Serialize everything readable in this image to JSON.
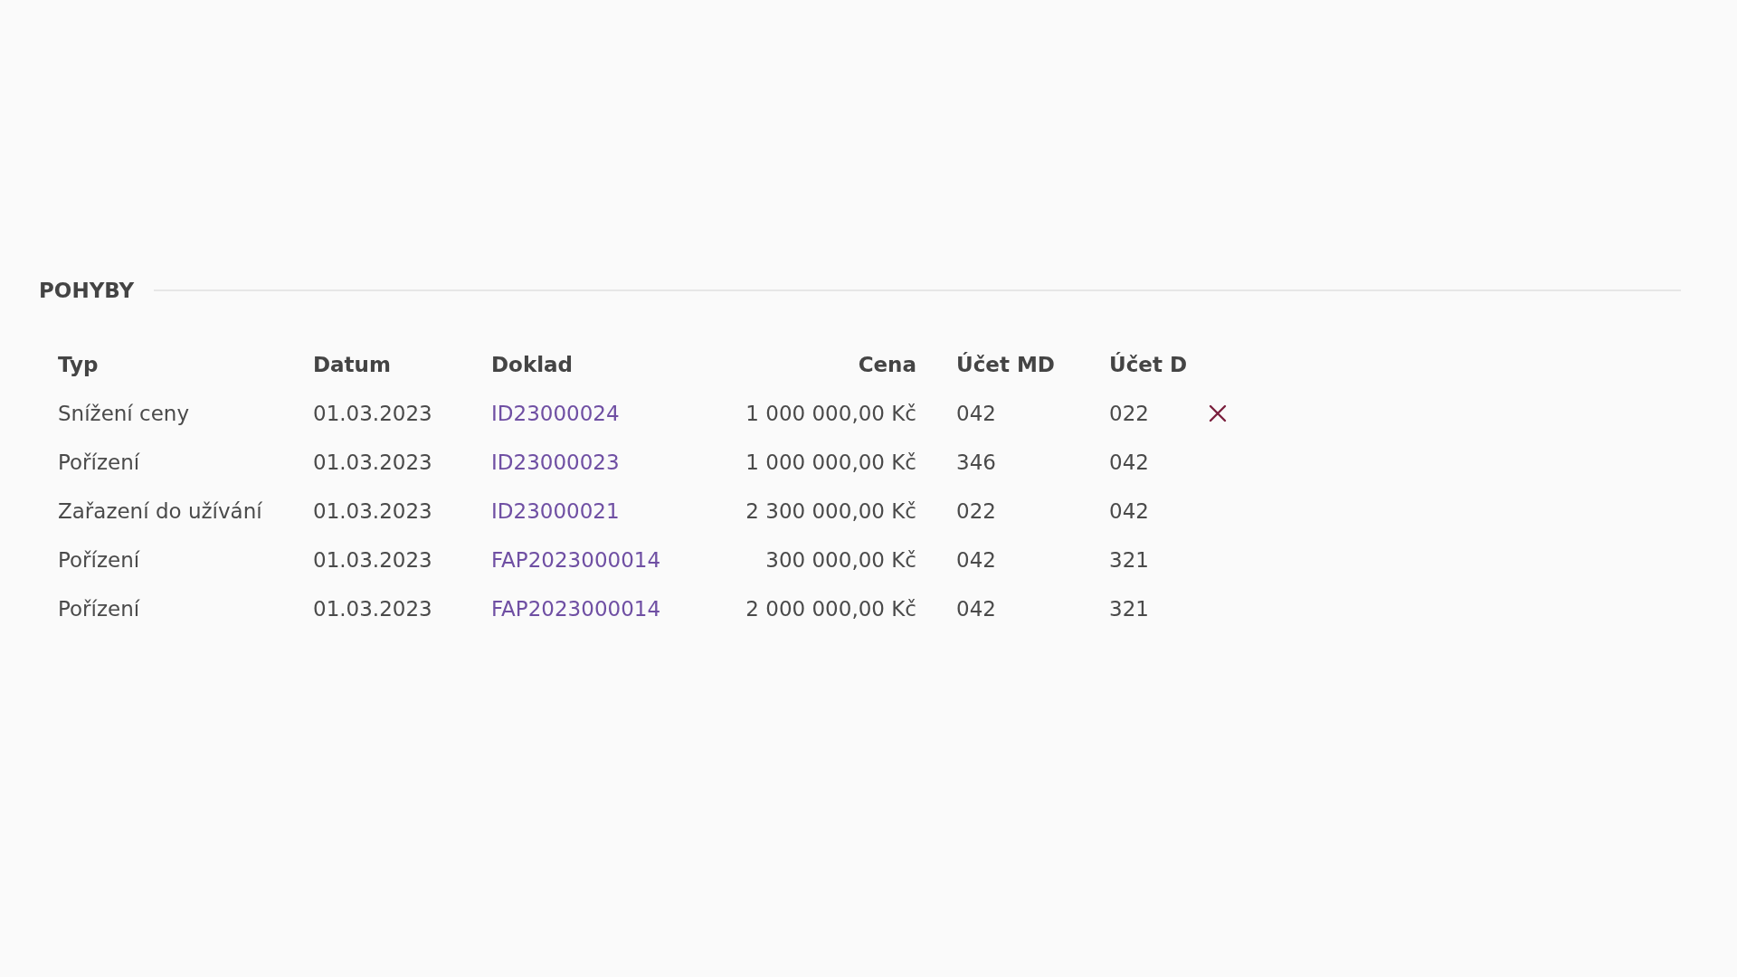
{
  "section": {
    "title": "POHYBY"
  },
  "table": {
    "columns": [
      {
        "label": "Typ"
      },
      {
        "label": "Datum"
      },
      {
        "label": "Doklad"
      },
      {
        "label": "Cena"
      },
      {
        "label": "Účet MD"
      },
      {
        "label": "Účet D"
      }
    ],
    "rows": [
      {
        "typ": "Snížení ceny",
        "datum": "01.03.2023",
        "doklad": "ID23000024",
        "cena": "1 000 000,00 Kč",
        "ucet_md": "042",
        "ucet_d": "022",
        "delete_shown": true
      },
      {
        "typ": "Pořízení",
        "datum": "01.03.2023",
        "doklad": "ID23000023",
        "cena": "1 000 000,00 Kč",
        "ucet_md": "346",
        "ucet_d": "042",
        "delete_shown": false
      },
      {
        "typ": "Zařazení do užívání",
        "datum": "01.03.2023",
        "doklad": "ID23000021",
        "cena": "2 300 000,00 Kč",
        "ucet_md": "022",
        "ucet_d": "042",
        "delete_shown": false
      },
      {
        "typ": "Pořízení",
        "datum": "01.03.2023",
        "doklad": "FAP2023000014",
        "cena": "300 000,00 Kč",
        "ucet_md": "042",
        "ucet_d": "321",
        "delete_shown": false
      },
      {
        "typ": "Pořízení",
        "datum": "01.03.2023",
        "doklad": "FAP2023000014",
        "cena": "2 000 000,00 Kč",
        "ucet_md": "042",
        "ucet_d": "321",
        "delete_shown": false
      }
    ]
  }
}
